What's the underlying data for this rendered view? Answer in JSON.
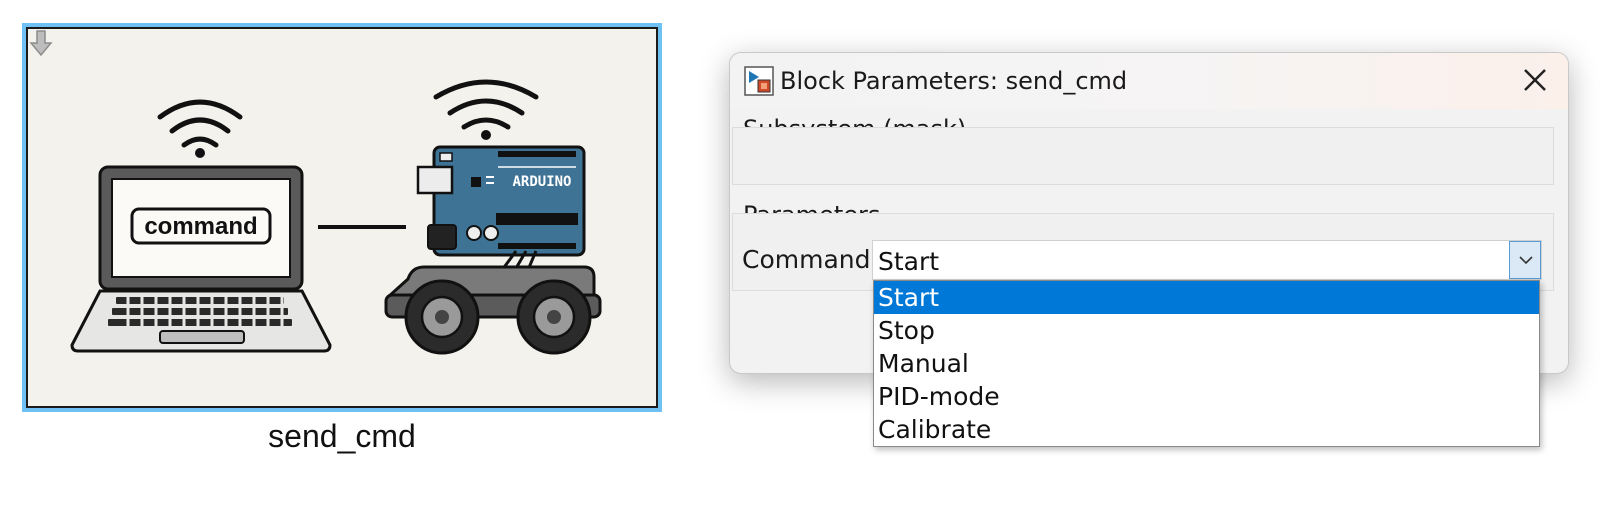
{
  "block": {
    "caption": "send_cmd",
    "screen_text": "command",
    "board_label": "ARDUINO",
    "accent_color": "#6ec1f2",
    "board_color": "#3f7396"
  },
  "dialog": {
    "title": "Block Parameters: send_cmd",
    "close_icon": "close-icon",
    "mask_section_label": "Subsystem (mask)",
    "parameters_section_label": "Parameters",
    "command_label": "Command",
    "command_value": "Start",
    "dropdown_options": [
      "Start",
      "Stop",
      "Manual",
      "PID-mode",
      "Calibrate"
    ],
    "selected_option": "Start",
    "selection_color": "#0078d7"
  }
}
